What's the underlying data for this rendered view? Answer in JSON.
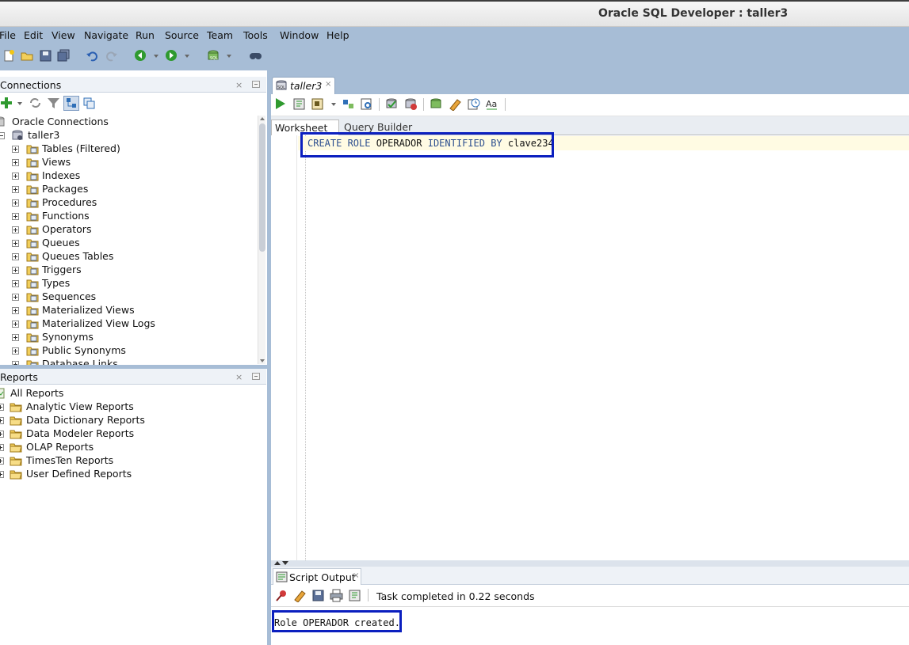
{
  "window": {
    "title": "Oracle SQL Developer : taller3"
  },
  "menu": [
    "File",
    "Edit",
    "View",
    "Navigate",
    "Run",
    "Source",
    "Team",
    "Tools",
    "Window",
    "Help"
  ],
  "main_toolbar": {
    "icons": [
      "new-icon",
      "open-icon",
      "save-icon",
      "save-all-icon",
      "undo-icon",
      "redo-icon",
      "back-icon",
      "forward-icon",
      "sql-connection-icon",
      "find-icon"
    ]
  },
  "connections_pane": {
    "title": "Connections",
    "close": "×",
    "root": "Oracle Connections",
    "connection": "taller3",
    "items": [
      "Tables (Filtered)",
      "Views",
      "Indexes",
      "Packages",
      "Procedures",
      "Functions",
      "Operators",
      "Queues",
      "Queues Tables",
      "Triggers",
      "Types",
      "Sequences",
      "Materialized Views",
      "Materialized View Logs",
      "Synonyms",
      "Public Synonyms",
      "Database Links"
    ]
  },
  "reports_pane": {
    "title": "Reports",
    "close": "×",
    "root": "All Reports",
    "items": [
      "Analytic View Reports",
      "Data Dictionary Reports",
      "Data Modeler Reports",
      "OLAP Reports",
      "TimesTen Reports",
      "User Defined Reports"
    ]
  },
  "editor": {
    "tab_label": "taller3",
    "tab_close": "×",
    "subtabs": [
      "Worksheet",
      "Query Builder"
    ],
    "code": {
      "kw1": "CREATE ROLE ",
      "name": "OPERADOR",
      "kw2": " IDENTIFIED BY ",
      "password": "clave234"
    }
  },
  "script_output": {
    "tab_label": "Script Output",
    "tab_close": "×",
    "status": "Task completed in 0.22 seconds",
    "result": "Role OPERADOR created."
  },
  "colors": {
    "chrome_blue": "#a7bdd6",
    "highlight_border": "#0b1fbf",
    "keyword": "#2d4f8f",
    "current_line": "#fffbe3"
  }
}
